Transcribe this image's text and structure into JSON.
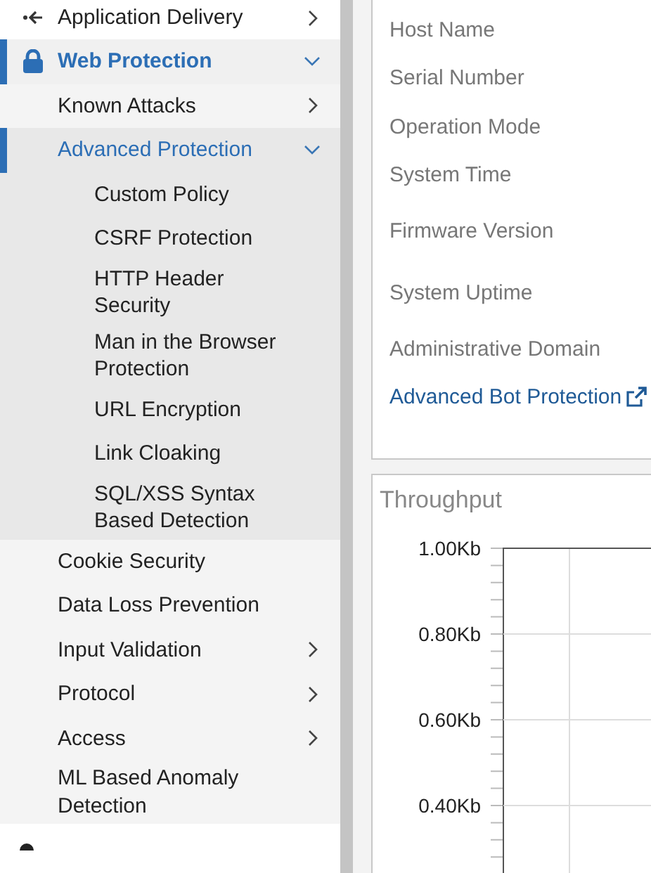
{
  "sidebar": {
    "items": [
      {
        "label": "Application Delivery",
        "expanded": false,
        "selected": false
      },
      {
        "label": "Web Protection",
        "expanded": true,
        "selected": true,
        "children": [
          {
            "label": "Known Attacks",
            "expanded": false,
            "selected": false
          },
          {
            "label": "Advanced Protection",
            "expanded": true,
            "selected": true,
            "children": [
              {
                "label": "Custom Policy",
                "selected": false
              },
              {
                "label": "CSRF Protection",
                "selected": false
              },
              {
                "label": "HTTP Header Security",
                "selected": false
              },
              {
                "label": "Man in the Browser Protection",
                "selected": false
              },
              {
                "label": "URL Encryption",
                "selected": false
              },
              {
                "label": "Link Cloaking",
                "selected": false
              },
              {
                "label": "SQL/XSS Syntax Based Detection",
                "selected": false
              }
            ]
          },
          {
            "label": "Cookie Security",
            "selected": false
          },
          {
            "label": "Data Loss Prevention",
            "selected": false
          },
          {
            "label": "Input Validation",
            "expanded": false,
            "selected": false
          },
          {
            "label": "Protocol",
            "expanded": false,
            "selected": false
          },
          {
            "label": "Access",
            "expanded": false,
            "selected": false
          },
          {
            "label": "ML Based Anomaly Detection",
            "selected": false
          }
        ]
      }
    ]
  },
  "system_info": {
    "fields": [
      {
        "label": "Host Name",
        "kind": "field"
      },
      {
        "label": "Serial Number",
        "kind": "field"
      },
      {
        "label": "Operation Mode",
        "kind": "field"
      },
      {
        "label": "System Time",
        "kind": "field"
      },
      {
        "label": "Firmware Version",
        "kind": "field"
      },
      {
        "label": "System Uptime",
        "kind": "field"
      },
      {
        "label": "Administrative Domain",
        "kind": "field"
      },
      {
        "label": "Advanced Bot Protection",
        "kind": "link"
      }
    ]
  },
  "throughput": {
    "title": "Throughput",
    "axis_labels": [
      "1.00Kb",
      "0.80Kb",
      "0.60Kb",
      "0.40Kb"
    ]
  }
}
